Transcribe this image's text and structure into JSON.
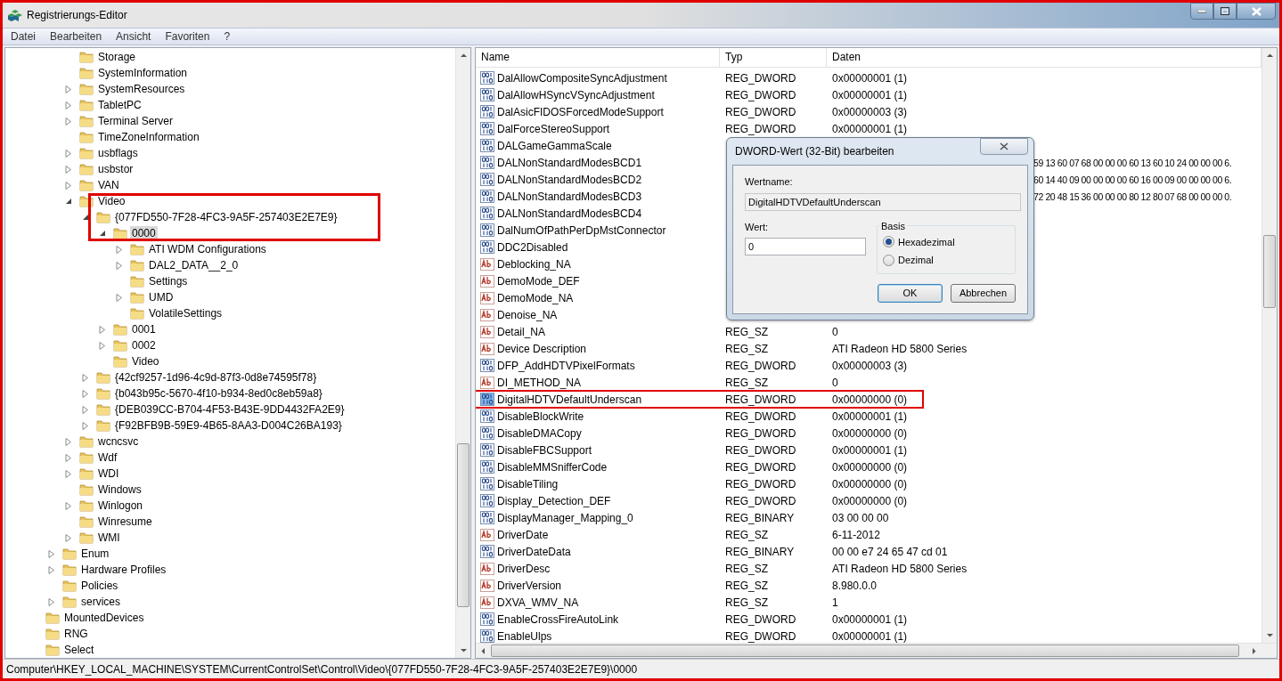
{
  "window": {
    "title": "Registrierungs-Editor"
  },
  "menu": [
    "Datei",
    "Bearbeiten",
    "Ansicht",
    "Favoriten",
    "?"
  ],
  "tree": {
    "items": [
      {
        "kind": "offscreen-parent",
        "children": [
          {
            "kind": "offscreen-parent",
            "children": [
              {
                "label": "Storage",
                "kind": "leaf",
                "selected": false,
                "outlined": false
              },
              {
                "label": "SystemInformation",
                "kind": "leaf",
                "selected": false,
                "outlined": false
              },
              {
                "label": "SystemResources",
                "kind": "branch",
                "expanded": false,
                "selected": false,
                "outlined": false
              },
              {
                "label": "TabletPC",
                "kind": "branch",
                "expanded": false,
                "selected": false,
                "outlined": false
              },
              {
                "label": "Terminal Server",
                "kind": "branch",
                "expanded": false,
                "selected": false,
                "outlined": false
              },
              {
                "label": "TimeZoneInformation",
                "kind": "leaf",
                "selected": false,
                "outlined": false
              },
              {
                "label": "usbflags",
                "kind": "branch",
                "expanded": false,
                "selected": false,
                "outlined": false
              },
              {
                "label": "usbstor",
                "kind": "branch",
                "expanded": false,
                "selected": false,
                "outlined": false
              },
              {
                "label": "VAN",
                "kind": "branch",
                "expanded": false,
                "selected": false,
                "outlined": false
              },
              {
                "label": "Video",
                "kind": "branch",
                "expanded": true,
                "selected": false,
                "outlined": true,
                "children": [
                  {
                    "label": "{077FD550-7F28-4FC3-9A5F-257403E2E7E9}",
                    "kind": "branch",
                    "expanded": true,
                    "selected": false,
                    "outlined": true,
                    "children": [
                      {
                        "label": "0000",
                        "kind": "branch",
                        "expanded": true,
                        "selected": true,
                        "outlined": true,
                        "children": [
                          {
                            "label": "ATI WDM Configurations",
                            "kind": "branch",
                            "expanded": false,
                            "selected": false,
                            "outlined": false
                          },
                          {
                            "label": "DAL2_DATA__2_0",
                            "kind": "branch",
                            "expanded": false,
                            "selected": false,
                            "outlined": false
                          },
                          {
                            "label": "Settings",
                            "kind": "leaf",
                            "selected": false,
                            "outlined": false
                          },
                          {
                            "label": "UMD",
                            "kind": "branch",
                            "expanded": false,
                            "selected": false,
                            "outlined": false
                          },
                          {
                            "label": "VolatileSettings",
                            "kind": "leaf",
                            "selected": false,
                            "outlined": false
                          }
                        ]
                      },
                      {
                        "label": "0001",
                        "kind": "branch",
                        "expanded": false,
                        "selected": false,
                        "outlined": false
                      },
                      {
                        "label": "0002",
                        "kind": "branch",
                        "expanded": false,
                        "selected": false,
                        "outlined": false
                      },
                      {
                        "label": "Video",
                        "kind": "leaf",
                        "selected": false,
                        "outlined": false
                      }
                    ]
                  },
                  {
                    "label": "{42cf9257-1d96-4c9d-87f3-0d8e74595f78}",
                    "kind": "branch",
                    "expanded": false,
                    "selected": false,
                    "outlined": false
                  },
                  {
                    "label": "{b043b95c-5670-4f10-b934-8ed0c8eb59a8}",
                    "kind": "branch",
                    "expanded": false,
                    "selected": false,
                    "outlined": false
                  },
                  {
                    "label": "{DEB039CC-B704-4F53-B43E-9DD4432FA2E9}",
                    "kind": "branch",
                    "expanded": false,
                    "selected": false,
                    "outlined": false
                  },
                  {
                    "label": "{F92BFB9B-59E9-4B65-8AA3-D004C26BA193}",
                    "kind": "branch",
                    "expanded": false,
                    "selected": false,
                    "outlined": false
                  }
                ]
              },
              {
                "label": "wcncsvc",
                "kind": "branch",
                "expanded": false,
                "selected": false,
                "outlined": false
              },
              {
                "label": "Wdf",
                "kind": "branch",
                "expanded": false,
                "selected": false,
                "outlined": false
              },
              {
                "label": "WDI",
                "kind": "branch",
                "expanded": false,
                "selected": false,
                "outlined": false
              },
              {
                "label": "Windows",
                "kind": "leaf",
                "selected": false,
                "outlined": false
              },
              {
                "label": "Winlogon",
                "kind": "branch",
                "expanded": false,
                "selected": false,
                "outlined": false
              },
              {
                "label": "Winresume",
                "kind": "leaf",
                "selected": false,
                "outlined": false
              },
              {
                "label": "WMI",
                "kind": "branch",
                "expanded": false,
                "selected": false,
                "outlined": false
              }
            ]
          },
          {
            "label": "Enum",
            "kind": "branch",
            "expanded": false,
            "selected": false,
            "outlined": false
          },
          {
            "label": "Hardware Profiles",
            "kind": "branch",
            "expanded": false,
            "selected": false,
            "outlined": false
          },
          {
            "label": "Policies",
            "kind": "leaf",
            "selected": false,
            "outlined": false
          },
          {
            "label": "services",
            "kind": "branch",
            "expanded": false,
            "selected": false,
            "outlined": false
          }
        ]
      },
      {
        "label": "MountedDevices",
        "kind": "leaf",
        "selected": false,
        "outlined": false
      },
      {
        "label": "RNG",
        "kind": "leaf",
        "selected": false,
        "outlined": false
      },
      {
        "label": "Select",
        "kind": "leaf",
        "selected": false,
        "outlined": false
      }
    ]
  },
  "values": {
    "columns": [
      "Name",
      "Typ",
      "Daten"
    ],
    "rows": [
      {
        "kind": "number",
        "name": "DalAllowCompositeSyncAdjustment",
        "type": "REG_DWORD",
        "data": "0x00000001 (1)",
        "selected": false,
        "outlined": false
      },
      {
        "kind": "number",
        "name": "DalAllowHSyncVSyncAdjustment",
        "type": "REG_DWORD",
        "data": "0x00000001 (1)",
        "selected": false,
        "outlined": false
      },
      {
        "kind": "number",
        "name": "DalAsicFIDOSForcedModeSupport",
        "type": "REG_DWORD",
        "data": "0x00000003 (3)",
        "selected": false,
        "outlined": false
      },
      {
        "kind": "number",
        "name": "DalForceStereoSupport",
        "type": "REG_DWORD",
        "data": "0x00000001 (1)",
        "selected": false,
        "outlined": false
      },
      {
        "kind": "number",
        "name": "DALGameGammaScale",
        "selected": false,
        "outlined": false
      },
      {
        "kind": "number",
        "name": "DALNonStandardModesBCD1",
        "data": "59 13 60 07 68 00 00 00 60 13 60 10 24 00 00 00 6.",
        "selected": false,
        "outlined": false
      },
      {
        "kind": "number",
        "name": "DALNonStandardModesBCD2",
        "data": "60 14 40 09 00 00 00 00 60 16 00 09 00 00 00 00 6.",
        "selected": false,
        "outlined": false
      },
      {
        "kind": "number",
        "name": "DALNonStandardModesBCD3",
        "data": "72 20 48 15 36 00 00 00 80 12 80 07 68 00 00 00 0.",
        "selected": false,
        "outlined": false
      },
      {
        "kind": "number",
        "name": "DALNonStandardModesBCD4",
        "selected": false,
        "outlined": false
      },
      {
        "kind": "number",
        "name": "DalNumOfPathPerDpMstConnector",
        "selected": false,
        "outlined": false
      },
      {
        "kind": "number",
        "name": "DDC2Disabled",
        "selected": false,
        "outlined": false
      },
      {
        "kind": "text",
        "name": "Deblocking_NA",
        "selected": false,
        "outlined": false
      },
      {
        "kind": "text",
        "name": "DemoMode_DEF",
        "selected": false,
        "outlined": false
      },
      {
        "kind": "text",
        "name": "DemoMode_NA",
        "selected": false,
        "outlined": false
      },
      {
        "kind": "text",
        "name": "Denoise_NA",
        "selected": false,
        "outlined": false
      },
      {
        "kind": "text",
        "name": "Detail_NA",
        "type": "REG_SZ",
        "data": "0",
        "selected": false,
        "outlined": false
      },
      {
        "kind": "text",
        "name": "Device Description",
        "type": "REG_SZ",
        "data": "ATI Radeon HD 5800 Series",
        "selected": false,
        "outlined": false
      },
      {
        "kind": "number",
        "name": "DFP_AddHDTVPixelFormats",
        "type": "REG_DWORD",
        "data": "0x00000003 (3)",
        "selected": false,
        "outlined": false
      },
      {
        "kind": "text",
        "name": "DI_METHOD_NA",
        "type": "REG_SZ",
        "data": "0",
        "selected": false,
        "outlined": false
      },
      {
        "kind": "number",
        "name": "DigitalHDTVDefaultUnderscan",
        "type": "REG_DWORD",
        "data": "0x00000000 (0)",
        "selected": true,
        "outlined": true
      },
      {
        "kind": "number",
        "name": "DisableBlockWrite",
        "type": "REG_DWORD",
        "data": "0x00000001 (1)",
        "selected": false,
        "outlined": false
      },
      {
        "kind": "number",
        "name": "DisableDMACopy",
        "type": "REG_DWORD",
        "data": "0x00000000 (0)",
        "selected": false,
        "outlined": false
      },
      {
        "kind": "number",
        "name": "DisableFBCSupport",
        "type": "REG_DWORD",
        "data": "0x00000001 (1)",
        "selected": false,
        "outlined": false
      },
      {
        "kind": "number",
        "name": "DisableMMSnifferCode",
        "type": "REG_DWORD",
        "data": "0x00000000 (0)",
        "selected": false,
        "outlined": false
      },
      {
        "kind": "number",
        "name": "DisableTiling",
        "type": "REG_DWORD",
        "data": "0x00000000 (0)",
        "selected": false,
        "outlined": false
      },
      {
        "kind": "number",
        "name": "Display_Detection_DEF",
        "type": "REG_DWORD",
        "data": "0x00000000 (0)",
        "selected": false,
        "outlined": false
      },
      {
        "kind": "number",
        "name": "DisplayManager_Mapping_0",
        "type": "REG_BINARY",
        "data": "03 00 00 00",
        "selected": false,
        "outlined": false
      },
      {
        "kind": "text",
        "name": "DriverDate",
        "type": "REG_SZ",
        "data": "6-11-2012",
        "selected": false,
        "outlined": false
      },
      {
        "kind": "number",
        "name": "DriverDateData",
        "type": "REG_BINARY",
        "data": "00 00 e7 24 65 47 cd 01",
        "selected": false,
        "outlined": false
      },
      {
        "kind": "text",
        "name": "DriverDesc",
        "type": "REG_SZ",
        "data": "ATI Radeon HD 5800 Series",
        "selected": false,
        "outlined": false
      },
      {
        "kind": "text",
        "name": "DriverVersion",
        "type": "REG_SZ",
        "data": "8.980.0.0",
        "selected": false,
        "outlined": false
      },
      {
        "kind": "text",
        "name": "DXVA_WMV_NA",
        "type": "REG_SZ",
        "data": "1",
        "selected": false,
        "outlined": false
      },
      {
        "kind": "number",
        "name": "EnableCrossFireAutoLink",
        "type": "REG_DWORD",
        "data": "0x00000001 (1)",
        "selected": false,
        "outlined": false
      },
      {
        "kind": "number",
        "name": "EnableUlps",
        "type": "REG_DWORD",
        "data": "0x00000001 (1)",
        "selected": false,
        "outlined": false
      }
    ]
  },
  "dialog": {
    "title": "DWORD-Wert (32-Bit) bearbeiten",
    "name_label": "Wertname:",
    "name_value": "DigitalHDTVDefaultUnderscan",
    "value_label": "Wert:",
    "value": "0",
    "base_label": "Basis",
    "bases": [
      {
        "label": "Hexadezimal",
        "selected": true
      },
      {
        "label": "Dezimal",
        "selected": false
      }
    ],
    "buttons": [
      {
        "label": "OK",
        "default": true
      },
      {
        "label": "Abbrechen",
        "default": false
      }
    ]
  },
  "status_bar": "Computer\\HKEY_LOCAL_MACHINE\\SYSTEM\\CurrentControlSet\\Control\\Video\\{077FD550-7F28-4FC3-9A5F-257403E2E7E9}\\0000"
}
